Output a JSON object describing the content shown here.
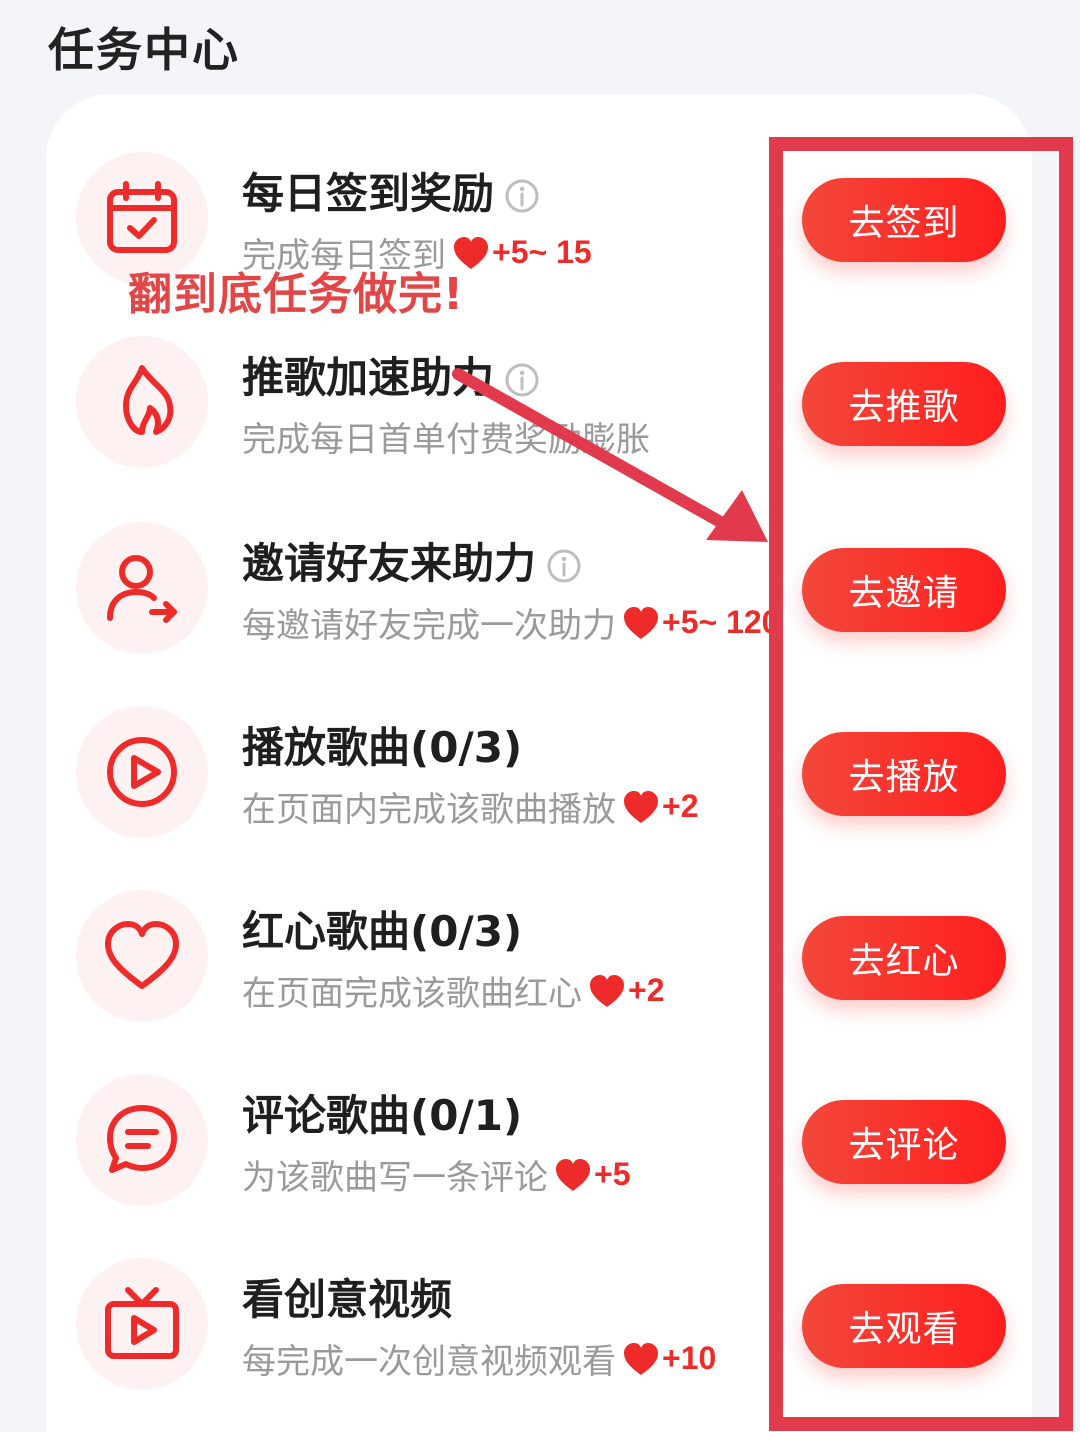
{
  "header": {
    "title": "任务中心"
  },
  "annotation": {
    "note": "翻到底任务做完!"
  },
  "tasks": [
    {
      "title": "每日签到奖励",
      "has_info": true,
      "desc": "完成每日签到",
      "has_heart": true,
      "reward": "+5~ 15",
      "button": "去签到",
      "icon": "calendar-check-icon"
    },
    {
      "title": "推歌加速助力",
      "has_info": true,
      "desc": "完成每日首单付费奖励膨胀",
      "has_heart": false,
      "reward": "",
      "button": "去推歌",
      "icon": "flame-icon"
    },
    {
      "title": "邀请好友来助力",
      "has_info": true,
      "desc": "每邀请好友完成一次助力",
      "has_heart": true,
      "reward": "+5~ 120",
      "button": "去邀请",
      "icon": "user-invite-icon"
    },
    {
      "title": "播放歌曲(0/3)",
      "has_info": false,
      "desc": "在页面内完成该歌曲播放",
      "has_heart": true,
      "reward": "+2",
      "button": "去播放",
      "icon": "play-icon"
    },
    {
      "title": "红心歌曲(0/3)",
      "has_info": false,
      "desc": "在页面完成该歌曲红心",
      "has_heart": true,
      "reward": "+2",
      "button": "去红心",
      "icon": "heart-outline-icon"
    },
    {
      "title": "评论歌曲(0/1)",
      "has_info": false,
      "desc": "为该歌曲写一条评论",
      "has_heart": true,
      "reward": "+5",
      "button": "去评论",
      "icon": "comment-icon"
    },
    {
      "title": "看创意视频",
      "has_info": false,
      "desc": "每完成一次创意视频观看",
      "has_heart": true,
      "reward": "+10",
      "button": "去观看",
      "icon": "tv-icon"
    }
  ],
  "colors": {
    "accent": "#ee2b2b",
    "button_start": "#f2473a",
    "button_end": "#ff1e1e",
    "icon_bg": "#fdf1f1",
    "annotation": "#e23a4d"
  }
}
